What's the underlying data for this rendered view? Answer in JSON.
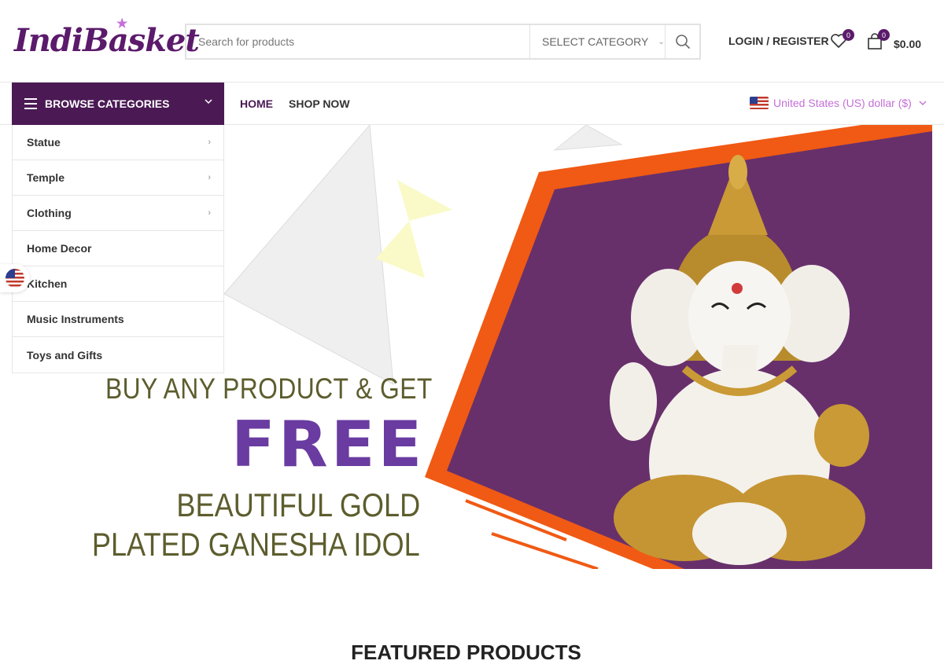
{
  "header": {
    "logo_text": "IndiBasket",
    "search": {
      "placeholder": "Search for products",
      "category_label": "SELECT CATEGORY"
    },
    "login_label": "LOGIN / REGISTER",
    "wishlist_count": "0",
    "cart_count": "0",
    "cart_total": "$0.00"
  },
  "nav": {
    "browse_label": "BROWSE CATEGORIES",
    "links": [
      "HOME",
      "SHOP NOW"
    ],
    "currency_label": "United States (US) dollar ($)"
  },
  "categories": [
    {
      "label": "Statue",
      "has_submenu": true
    },
    {
      "label": "Temple",
      "has_submenu": true
    },
    {
      "label": "Clothing",
      "has_submenu": true
    },
    {
      "label": "Home Decor",
      "has_submenu": false
    },
    {
      "label": "Kitchen",
      "has_submenu": false
    },
    {
      "label": "Music Instruments",
      "has_submenu": false
    },
    {
      "label": "Toys and Gifts",
      "has_submenu": false
    }
  ],
  "banner": {
    "line1": "BUY ANY PRODUCT & GET",
    "line2": "FREE",
    "line3": "BEAUTIFUL GOLD",
    "line4": "PLATED GANESHA IDOL"
  },
  "featured_title": "FEATURED PRODUCTS",
  "colors": {
    "brand_purple": "#4b1a54",
    "accent_orange": "#f05a14",
    "banner_purple": "#67306b",
    "pink": "#c56fd8"
  }
}
